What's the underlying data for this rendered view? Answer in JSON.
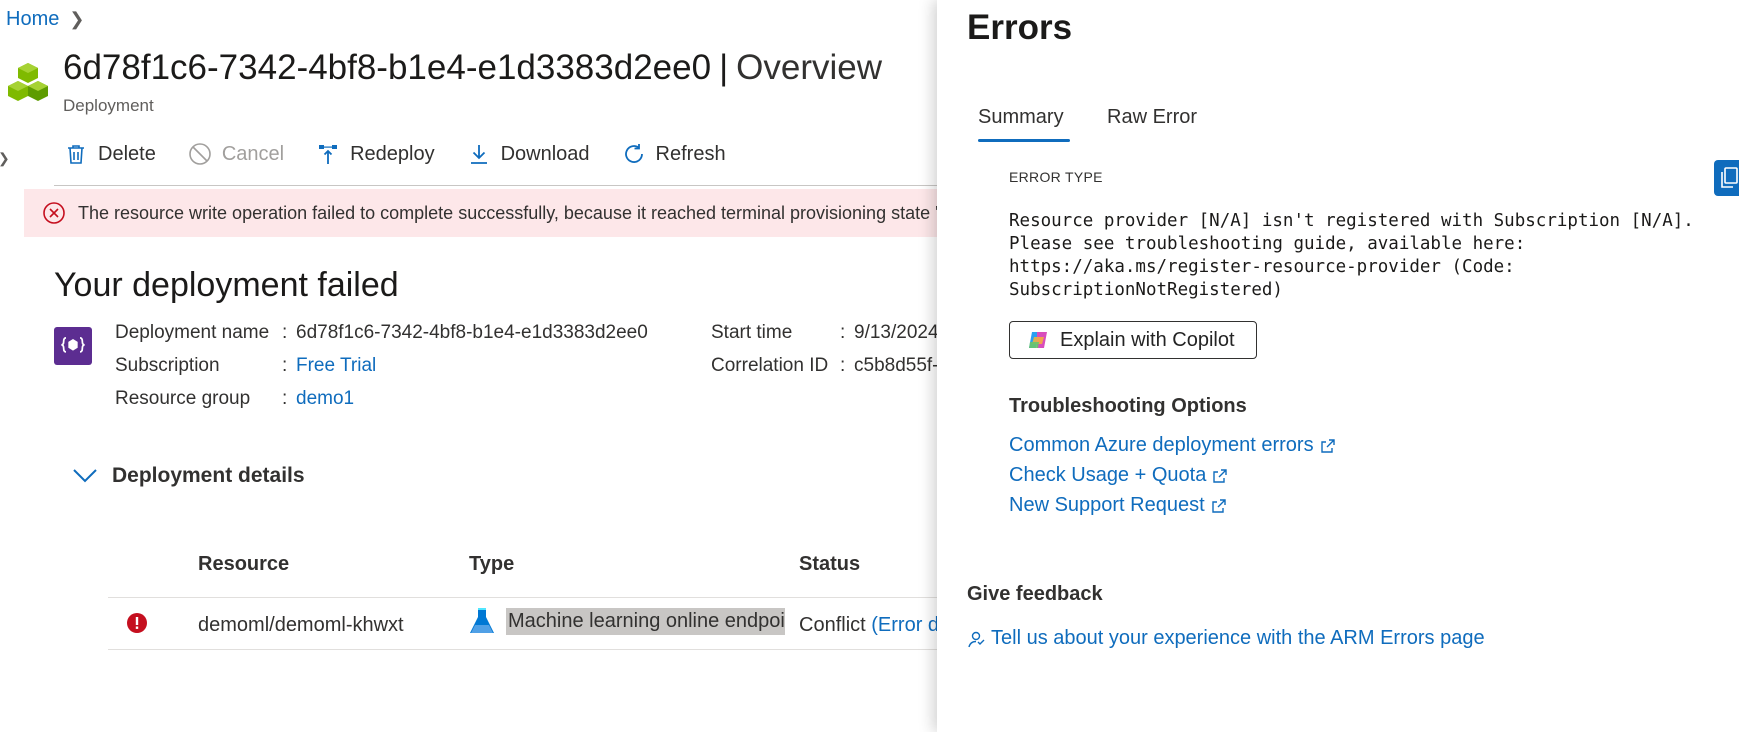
{
  "breadcrumb": {
    "home": "Home"
  },
  "header": {
    "title": "6d78f1c6-7342-4bf8-b1e4-e1d3383d2ee0",
    "separator": "|",
    "section": "Overview",
    "subtitle": "Deployment"
  },
  "toolbar": {
    "delete": "Delete",
    "cancel": "Cancel",
    "redeploy": "Redeploy",
    "download": "Download",
    "refresh": "Refresh"
  },
  "error_bar": {
    "text": "The resource write operation failed to complete successfully, because it reached terminal provisioning state '"
  },
  "status_heading": "Your deployment failed",
  "deployment_info": {
    "name_label": "Deployment name",
    "name_value": "6d78f1c6-7342-4bf8-b1e4-e1d3383d2ee0",
    "subscription_label": "Subscription",
    "subscription_value": "Free Trial",
    "resource_group_label": "Resource group",
    "resource_group_value": "demo1",
    "start_time_label": "Start time",
    "start_time_value": "9/13/2024",
    "correlation_label": "Correlation ID",
    "correlation_value": "c5b8d55f-",
    "colon": ":"
  },
  "details": {
    "toggle_label": "Deployment details",
    "columns": {
      "resource": "Resource",
      "type": "Type",
      "status": "Status"
    },
    "rows": [
      {
        "resource": "demoml/demoml-khwxt",
        "type": "Machine learning online endpoint",
        "status": "Conflict",
        "status_link": "(Error de"
      }
    ]
  },
  "errors_panel": {
    "title": "Errors",
    "tabs": {
      "summary": "Summary",
      "raw": "Raw Error"
    },
    "error_type_label": "ERROR TYPE",
    "error_message": "Resource provider [N/A] isn't registered with Subscription [N/A].\nPlease see troubleshooting guide, available here:\nhttps://aka.ms/register-resource-provider (Code:\nSubscriptionNotRegistered)",
    "copilot_button": "Explain with Copilot",
    "troubleshooting_title": "Troubleshooting Options",
    "links": {
      "common_errors": "Common Azure deployment errors",
      "usage_quota": "Check Usage + Quota",
      "support": "New Support Request"
    },
    "feedback_title": "Give feedback",
    "feedback_link": "Tell us about your experience with the ARM Errors page"
  },
  "colors": {
    "accent": "#0f6cbd",
    "error_bar_bg": "#fde7e9",
    "error_red": "#c50f1f",
    "deployment_icon_bg": "#5c2d91"
  },
  "icons": [
    "chevron-right-icon",
    "cube-cluster-icon",
    "trash-icon",
    "cancel-icon",
    "redeploy-icon",
    "download-icon",
    "refresh-icon",
    "error-circle-icon",
    "deployment-template-icon",
    "chevron-down-icon",
    "exclamation-icon",
    "flask-icon",
    "copy-icon",
    "copilot-icon",
    "external-link-icon",
    "feedback-icon"
  ]
}
